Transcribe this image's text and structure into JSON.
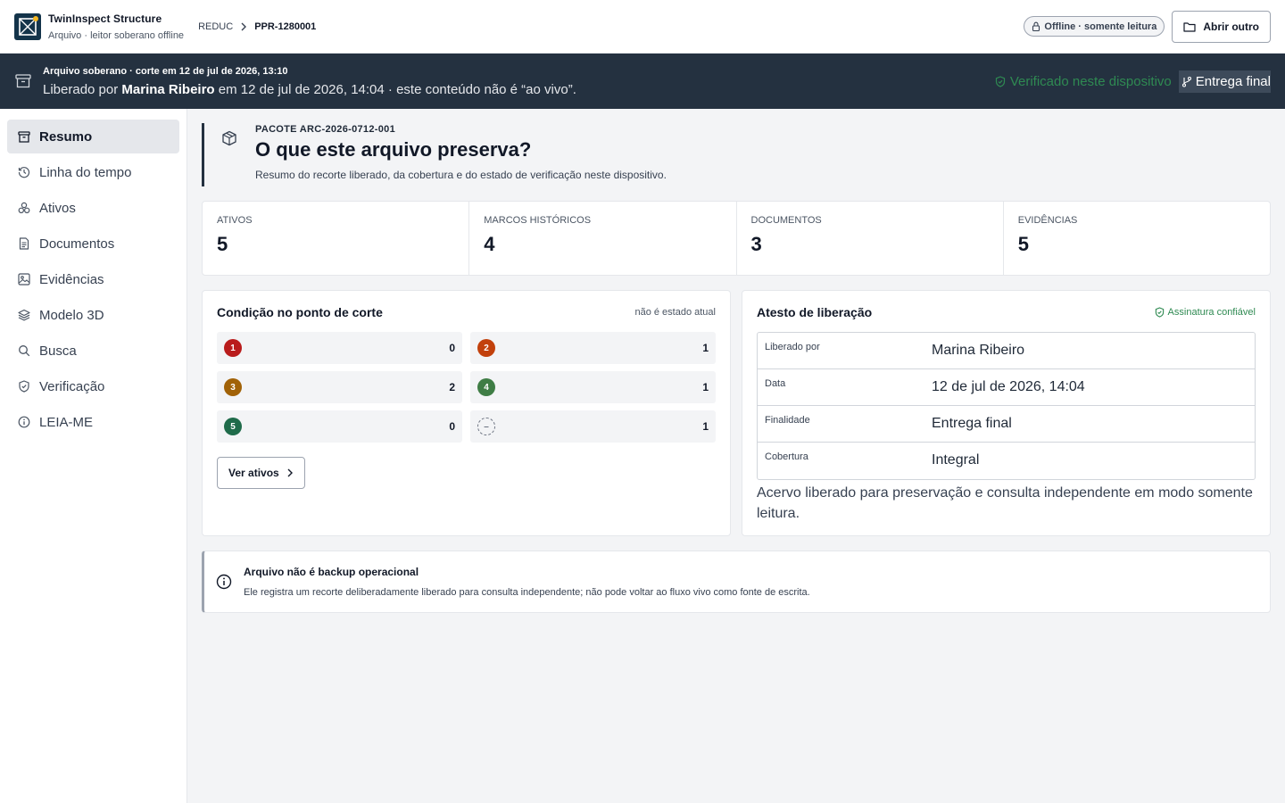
{
  "header": {
    "app_title": "TwinInspect  Structure",
    "app_subtitle": "Arquivo · leitor soberano offline",
    "breadcrumb": {
      "root": "REDUC",
      "current": "PPR-1280001"
    },
    "offline_badge": "Offline · somente leitura",
    "open_other_label": "Abrir outro"
  },
  "banner": {
    "line1": "Arquivo soberano · corte em 12 de jul de 2026, 13:10",
    "line2_prefix": "Liberado por ",
    "line2_person": "Marina Ribeiro",
    "line2_suffix": " em 12 de jul de 2026, 14:04 · este conteúdo não é “ao vivo”.",
    "verified": "Verificado neste dispositivo",
    "final_chip": "Entrega final"
  },
  "sidebar": {
    "items": [
      {
        "label": "Resumo",
        "icon": "archive-icon"
      },
      {
        "label": "Linha do tempo",
        "icon": "history-icon"
      },
      {
        "label": "Ativos",
        "icon": "assets-icon"
      },
      {
        "label": "Documentos",
        "icon": "document-icon"
      },
      {
        "label": "Evidências",
        "icon": "image-icon"
      },
      {
        "label": "Modelo 3D",
        "icon": "layers-icon"
      },
      {
        "label": "Busca",
        "icon": "search-icon"
      },
      {
        "label": "Verificação",
        "icon": "shield-icon"
      },
      {
        "label": "LEIA-ME",
        "icon": "info-icon"
      }
    ]
  },
  "package": {
    "id": "PACOTE ARC-2026-0712-001",
    "title": "O que este arquivo preserva?",
    "description": "Resumo do recorte liberado, da cobertura e do estado de verificação neste dispositivo."
  },
  "stats": [
    {
      "label": "ATIVOS",
      "value": "5"
    },
    {
      "label": "MARCOS HISTÓRICOS",
      "value": "4"
    },
    {
      "label": "DOCUMENTOS",
      "value": "3"
    },
    {
      "label": "EVIDÊNCIAS",
      "value": "5"
    }
  ],
  "condition": {
    "title": "Condição no ponto de corte",
    "hint": "não é estado atual",
    "levels": [
      {
        "badge": "1",
        "count": "0",
        "color": "#b91c1c"
      },
      {
        "badge": "2",
        "count": "1",
        "color": "#c2410c"
      },
      {
        "badge": "3",
        "count": "2",
        "color": "#a16207"
      },
      {
        "badge": "4",
        "count": "1",
        "color": "#3f7d45"
      },
      {
        "badge": "5",
        "count": "0",
        "color": "#1f6b4a"
      },
      {
        "badge": "–",
        "count": "1",
        "color": ""
      }
    ],
    "button_label": "Ver ativos"
  },
  "attestation": {
    "title": "Atesto de liberação",
    "signature": "Assinatura confiável",
    "rows": [
      {
        "key": "Liberado por",
        "value": "Marina Ribeiro"
      },
      {
        "key": "Data",
        "value": "12 de jul de 2026, 14:04"
      },
      {
        "key": "Finalidade",
        "value": "Entrega final"
      },
      {
        "key": "Cobertura",
        "value": "Integral"
      }
    ],
    "note": "Acervo liberado para preservação e consulta independente em modo somente leitura."
  },
  "notice": {
    "title": "Arquivo não é backup operacional",
    "description": "Ele registra um recorte deliberadamente liberado para consulta independente; não pode voltar ao fluxo vivo como fonte de escrita."
  },
  "colors": {
    "banner_bg": "#243140",
    "verified_green": "#2f8a52"
  }
}
